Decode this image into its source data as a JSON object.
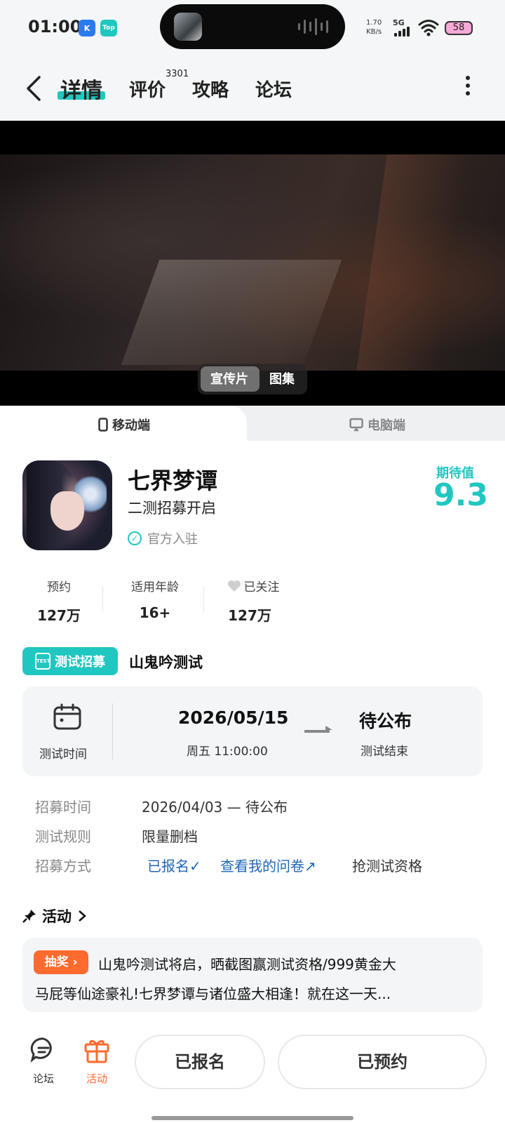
{
  "status_bar": {
    "time": "01:00",
    "app_badge_1": "K",
    "app_badge_2": "Top",
    "net_speed_value": "1.70",
    "net_speed_unit": "KB/s",
    "network": "5G",
    "battery": "58"
  },
  "nav": {
    "tabs": [
      {
        "label": "详情",
        "active": true
      },
      {
        "label": "评价",
        "badge": "3301"
      },
      {
        "label": "攻略"
      },
      {
        "label": "论坛"
      }
    ]
  },
  "media": {
    "options": [
      "宣传片",
      "图集"
    ],
    "selected": "宣传片"
  },
  "platform": {
    "tabs": [
      {
        "label": "移动端",
        "icon": "phone-icon",
        "active": true
      },
      {
        "label": "电脑端",
        "icon": "monitor-icon"
      }
    ]
  },
  "app": {
    "title": "七界梦谭",
    "subtitle": "二测招募开启",
    "verified": "官方入驻",
    "expect_label": "期待值",
    "expect_value": "9.3",
    "accent": "#20c7c0"
  },
  "stats": [
    {
      "label": "预约",
      "value": "127万"
    },
    {
      "label": "适用年龄",
      "value": "16+"
    },
    {
      "label": "已关注",
      "value": "127万",
      "icon": "heart-icon"
    }
  ],
  "test": {
    "badge": "测试招募",
    "badge_icon_text": "TEST",
    "name": "山鬼吟测试",
    "time_label": "测试时间",
    "start_date": "2026/05/15",
    "start_time": "周五 11:00:00",
    "end_date": "待公布",
    "end_label": "测试结束",
    "info": [
      {
        "label": "招募时间",
        "value": "2026/04/03 — 待公布"
      },
      {
        "label": "测试规则",
        "value": "限量删档"
      },
      {
        "label": "招募方式",
        "signed_up": "已报名✓",
        "questionnaire": "查看我的问卷↗",
        "grab": "抢测试资格"
      }
    ]
  },
  "activity": {
    "heading": "活动",
    "tag": "抽奖",
    "line1": "山鬼吟测试将启，晒截图赢测试资格/999黄金大",
    "line2": "马屁等仙途豪礼!七界梦谭与诸位盛大相逢！就在这一天...",
    "tag_color": "#ff6a2e"
  },
  "bottom": {
    "forum_label": "论坛",
    "activity_label": "活动",
    "signup_button": "已报名",
    "reserve_button": "已预约"
  }
}
